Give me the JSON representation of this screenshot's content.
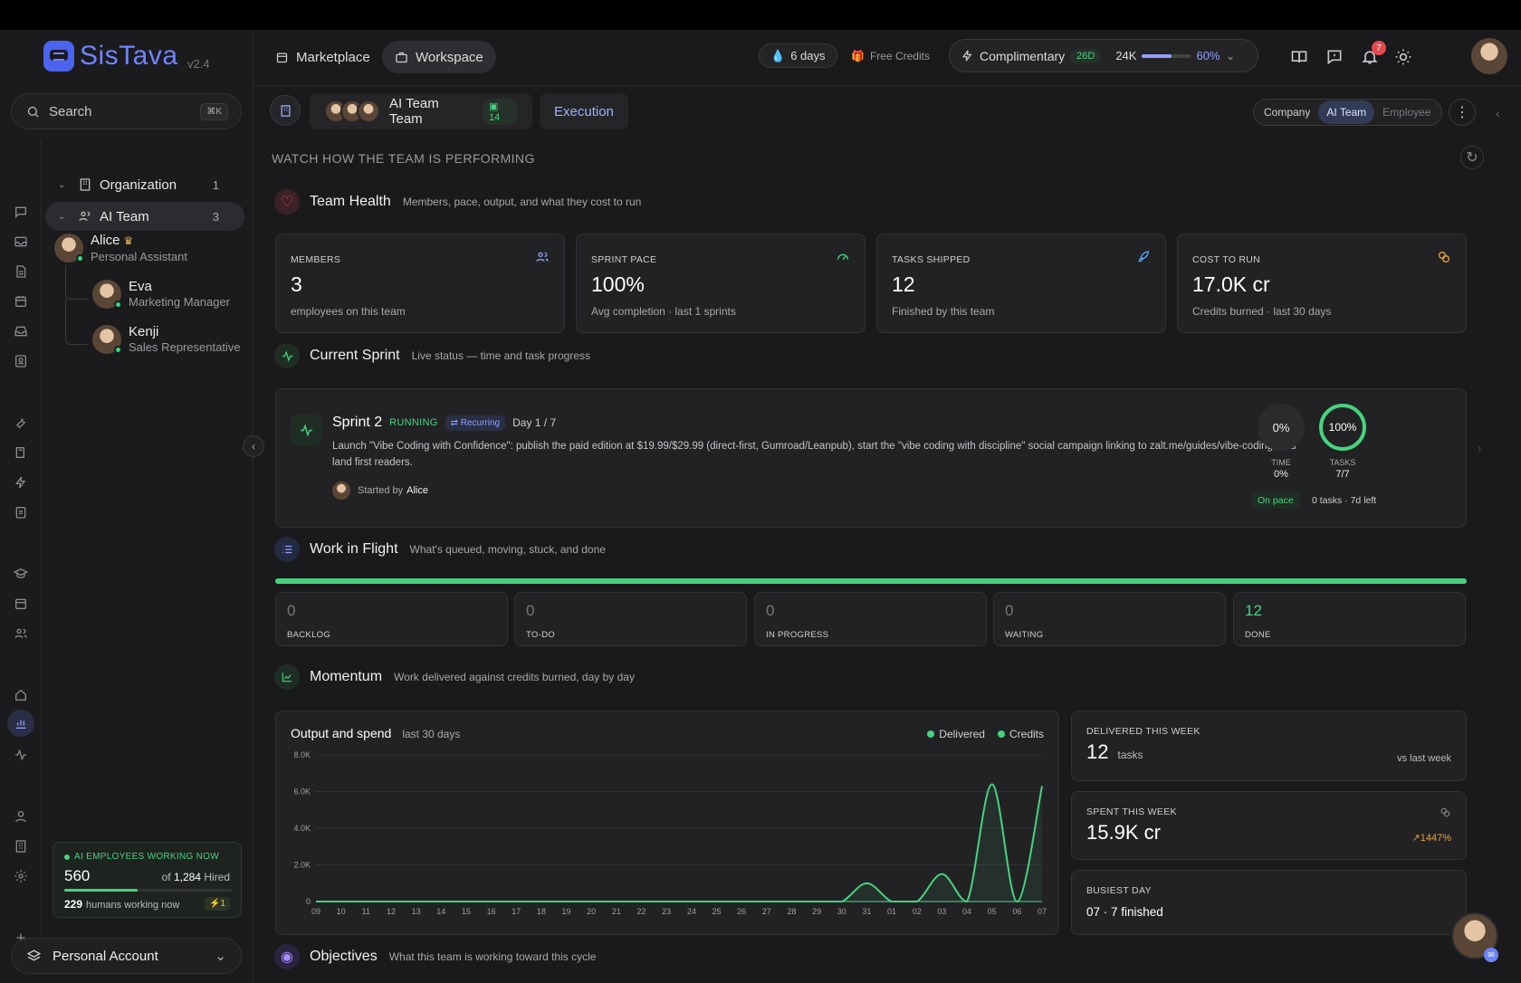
{
  "app": {
    "name": "SisTava",
    "version": "v2.4"
  },
  "search": {
    "label": "Search",
    "shortcut": "⌘K"
  },
  "topbar": {
    "tabs": [
      {
        "label": "Marketplace",
        "icon": "store-icon"
      },
      {
        "label": "Workspace",
        "icon": "briefcase-icon"
      }
    ],
    "streak": "6 days",
    "free_credits": "Free Credits",
    "plan": {
      "label": "Complimentary",
      "days_badge": "26D",
      "credits": "24K",
      "usage_pct": "60%",
      "usage_fraction": 0.6
    },
    "notifications_count": "7",
    "accent": "#6e84ff"
  },
  "subheader": {
    "team_name": "AI Team Team",
    "team_count": "14",
    "view": "Execution",
    "scope": [
      "Company",
      "AI Team",
      "Employee"
    ],
    "scope_selected": "AI Team"
  },
  "sidebar": {
    "org": {
      "label": "Organization",
      "count": "1"
    },
    "team": {
      "label": "AI Team",
      "count": "3"
    },
    "members": [
      {
        "name": "Alice",
        "role": "Personal Assistant"
      },
      {
        "name": "Eva",
        "role": "Marketing Manager"
      },
      {
        "name": "Kenji",
        "role": "Sales Representative"
      }
    ],
    "working": {
      "title": "AI EMPLOYEES WORKING NOW",
      "count": "560",
      "of_label": "of",
      "hired_total": "1,284",
      "hired_label": "Hired",
      "fill_fraction": 0.44,
      "humans": "229",
      "humans_label": "humans working now",
      "bolt_badge": "⚡1"
    },
    "account": "Personal Account"
  },
  "main": {
    "caption": "WATCH HOW THE TEAM IS PERFORMING",
    "team_health": {
      "title": "Team Health",
      "subtitle": "Members, pace, output, and what they cost to run",
      "stats": [
        {
          "label": "MEMBERS",
          "value": "3",
          "desc": "employees on this team",
          "icon": "users-icon"
        },
        {
          "label": "SPRINT PACE",
          "value": "100%",
          "desc": "Avg completion · last 1 sprints",
          "icon": "gauge-icon"
        },
        {
          "label": "TASKS SHIPPED",
          "value": "12",
          "desc": "Finished by this team",
          "icon": "rocket-icon"
        },
        {
          "label": "COST TO RUN",
          "value": "17.0K cr",
          "desc": "Credits burned · last 30 days",
          "icon": "coins-icon"
        }
      ]
    },
    "sprint_section": {
      "title": "Current Sprint",
      "subtitle": "Live status — time and task progress"
    },
    "sprint": {
      "name": "Sprint 2",
      "status": "RUNNING",
      "recurring": "Recurring",
      "day": "Day 1 / 7",
      "description": "Launch \"Vibe Coding with Confidence\": publish the paid edition at $19.99/$29.99 (direct-first, Gumroad/Leanpub), start the \"vibe coding with discipline\" social campaign linking to zalt.me/guides/vibe-coding, and land first readers.",
      "started_by_label": "Started by",
      "started_by": "Alice",
      "time_ring": "0%",
      "time_label": "TIME",
      "time_value": "0%",
      "tasks_ring": "100%",
      "tasks_label": "TASKS",
      "tasks_value": "7/7",
      "tasks_fraction": 1.0,
      "pace_badge": "On pace",
      "remaining": "0 tasks · 7d left"
    },
    "flight_section": {
      "title": "Work in Flight",
      "subtitle": "What's queued, moving, stuck, and done"
    },
    "flight": [
      {
        "value": "0",
        "label": "BACKLOG"
      },
      {
        "value": "0",
        "label": "TO-DO"
      },
      {
        "value": "0",
        "label": "IN PROGRESS"
      },
      {
        "value": "0",
        "label": "WAITING"
      },
      {
        "value": "12",
        "label": "DONE"
      }
    ],
    "momentum_section": {
      "title": "Momentum",
      "subtitle": "Work delivered against credits burned, day by day"
    },
    "chart_title": "Output and spend",
    "chart_range": "last 30 days",
    "side_stats": {
      "delivered": {
        "label": "DELIVERED THIS WEEK",
        "value": "12",
        "unit": "tasks",
        "compare": "vs last week"
      },
      "spent": {
        "label": "SPENT THIS WEEK",
        "value": "15.9K cr",
        "change": "1447%"
      },
      "busiest": {
        "label": "BUSIEST DAY",
        "value": "07 · 7 finished"
      }
    },
    "objectives_section": {
      "title": "Objectives",
      "subtitle": "What this team is working toward this cycle"
    }
  },
  "chart_data": {
    "type": "line",
    "title": "Output and spend",
    "subtitle": "last 30 days",
    "categories": [
      "09",
      "10",
      "11",
      "12",
      "13",
      "14",
      "15",
      "16",
      "17",
      "18",
      "19",
      "20",
      "21",
      "22",
      "23",
      "24",
      "25",
      "26",
      "27",
      "28",
      "29",
      "30",
      "31",
      "01",
      "02",
      "03",
      "04",
      "05",
      "06",
      "07"
    ],
    "series": [
      {
        "name": "Delivered",
        "values": [
          0,
          0,
          0,
          0,
          0,
          0,
          0,
          0,
          0,
          0,
          0,
          0,
          0,
          0,
          0,
          0,
          0,
          0,
          0,
          0,
          0,
          0,
          0,
          0,
          0,
          0,
          0,
          0,
          0,
          0
        ]
      },
      {
        "name": "Credits",
        "values": [
          0,
          0,
          0,
          0,
          0,
          0,
          0,
          0,
          0,
          0,
          0,
          0,
          0,
          0,
          0,
          0,
          0,
          0,
          0,
          0,
          0,
          0,
          1000,
          0,
          0,
          1500,
          0,
          6400,
          0,
          6300
        ]
      }
    ],
    "yticks": [
      "0",
      "2.0K",
      "4.0K",
      "6.0K",
      "8.0K"
    ],
    "ylim": [
      0,
      8000
    ],
    "legend": "top-right",
    "colors": {
      "Delivered": "#47d37e",
      "Credits": "#47d37e"
    }
  }
}
